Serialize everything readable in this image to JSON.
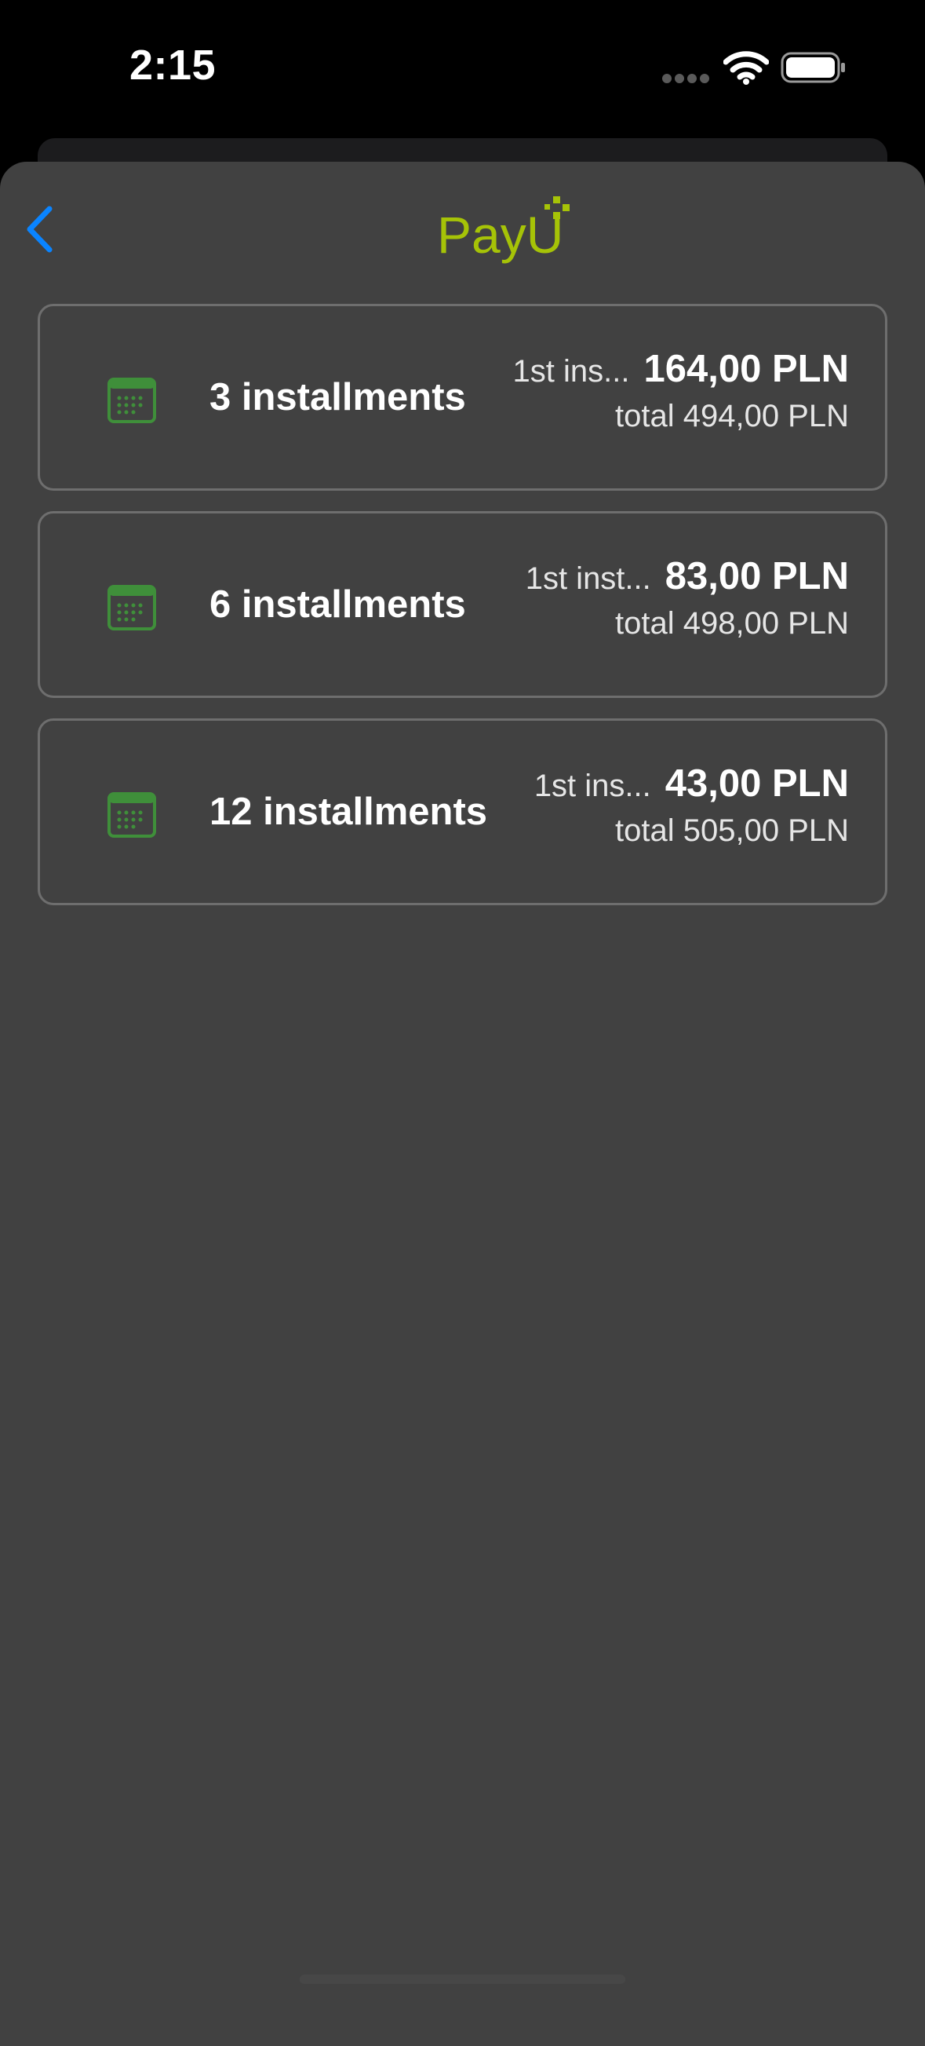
{
  "status_bar": {
    "time": "2:15"
  },
  "header": {
    "back_icon": "chevron-left-icon",
    "logo_text": "PayU",
    "logo_icon": "payu-logo-icon"
  },
  "installment_options": [
    {
      "title": "3 installments",
      "first_label": "1st ins...",
      "first_amount": "164,00 PLN",
      "total": "total 494,00 PLN"
    },
    {
      "title": "6 installments",
      "first_label": "1st inst...",
      "first_amount": "83,00 PLN",
      "total": "total 498,00 PLN"
    },
    {
      "title": "12 installments",
      "first_label": "1st ins...",
      "first_amount": "43,00 PLN",
      "total": "total 505,00 PLN"
    }
  ],
  "colors": {
    "accent_blue": "#0a84ff",
    "payu_green": "#a6c307",
    "calendar_green": "#3f8f3a",
    "sheet_background": "#414141",
    "card_border": "#6e6e6e"
  }
}
